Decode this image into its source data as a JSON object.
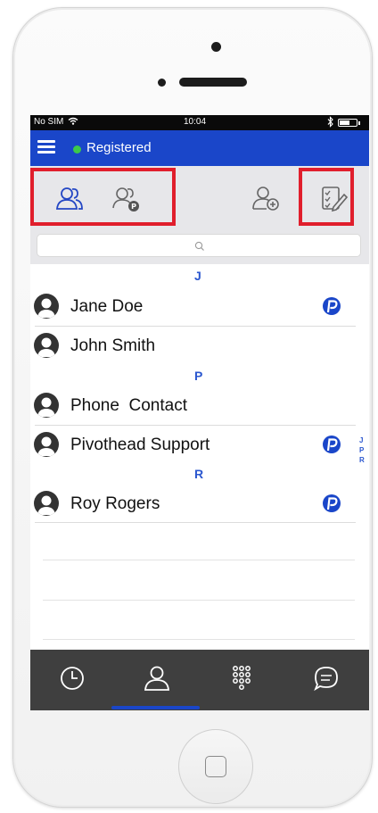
{
  "status_bar": {
    "carrier": "No SIM",
    "time": "10:04",
    "battery_level": 0.6
  },
  "header": {
    "status": "Registered",
    "status_color": "#3cc94a",
    "accent": "#1a46c9"
  },
  "toolbar": {
    "icons": [
      "contacts-icon",
      "pivothead-contacts-icon",
      "add-contact-icon",
      "edit-list-icon"
    ],
    "highlight_color": "#e01e2c"
  },
  "search": {
    "placeholder": "",
    "value": ""
  },
  "contacts": {
    "sections": [
      {
        "letter": "J",
        "items": [
          {
            "name": "Jane Doe",
            "pivothead": true
          },
          {
            "name": "John Smith",
            "pivothead": false
          }
        ]
      },
      {
        "letter": "P",
        "items": [
          {
            "name": "Phone  Contact",
            "pivothead": false
          },
          {
            "name": "Pivothead Support",
            "pivothead": true
          }
        ]
      },
      {
        "letter": "R",
        "items": [
          {
            "name": "Roy Rogers",
            "pivothead": true
          }
        ]
      }
    ]
  },
  "index": [
    "J",
    "P",
    "R"
  ],
  "tabs": [
    {
      "name": "recents-icon",
      "active": false
    },
    {
      "name": "contacts-icon",
      "active": true
    },
    {
      "name": "keypad-icon",
      "active": false
    },
    {
      "name": "messages-icon",
      "active": false
    }
  ]
}
